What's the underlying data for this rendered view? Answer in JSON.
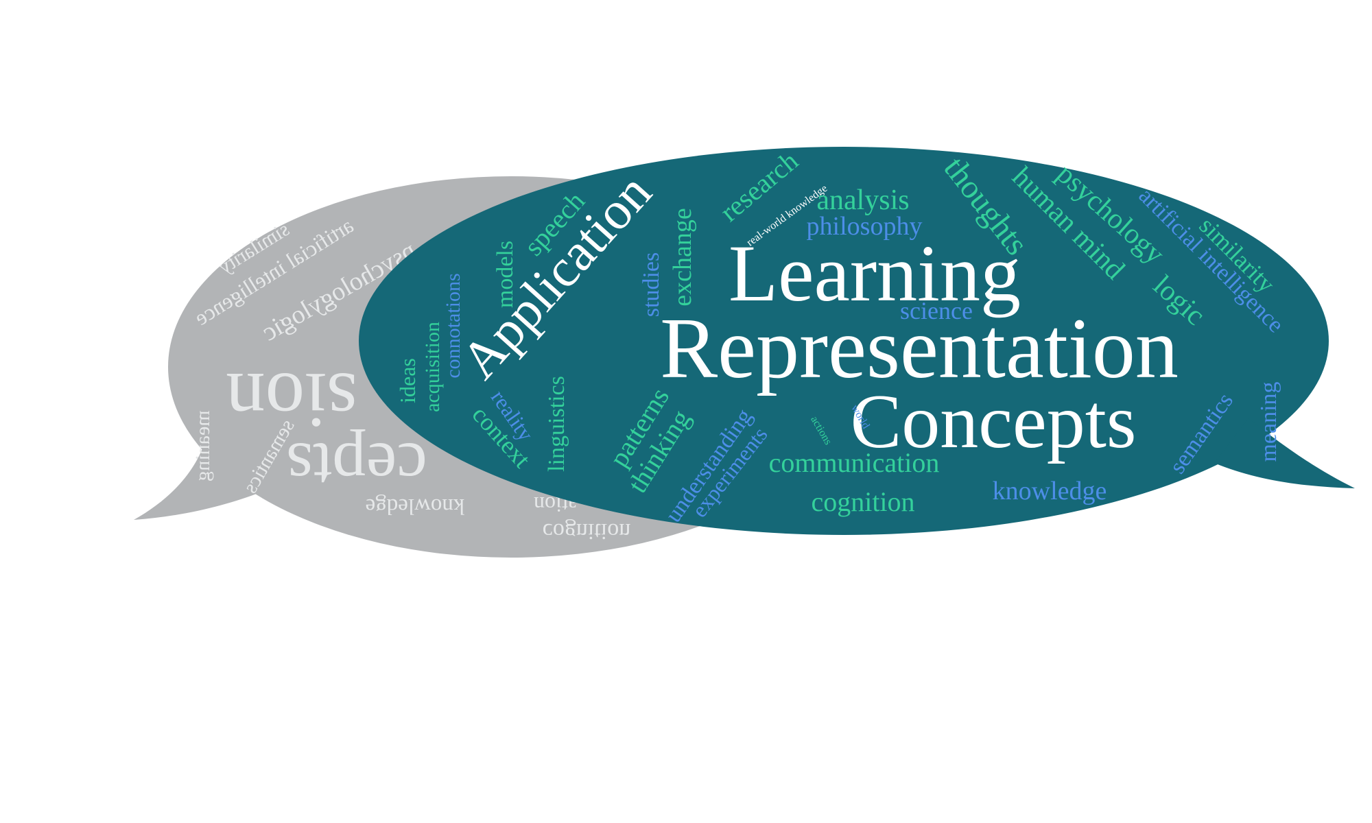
{
  "colors": {
    "background": "#ffffff",
    "front_bubble": "#156877",
    "back_bubble": "#b2b4b6",
    "white_text": "#ffffff",
    "green_text": "#34d19b",
    "blue_text": "#4d8ee8",
    "ghost_text": "#e6e8e9"
  },
  "front_cloud": {
    "learning": "Learning",
    "representation": "Representation",
    "concepts": "Concepts",
    "application": "Application",
    "speech": "speech",
    "research": "research",
    "real_world_knowledge": "real-world knowledge",
    "analysis": "analysis",
    "philosophy": "philosophy",
    "thoughts": "thoughts",
    "human_mind": "human mind",
    "psychology": "psychology",
    "artificial_intelligence": "artificial intelligence",
    "similarity": "similarity",
    "logic": "logic",
    "science": "science",
    "models": "models",
    "connotations": "connotations",
    "acquisition": "acquisition",
    "ideas": "ideas",
    "studies": "studies",
    "exchange": "exchange",
    "reality": "reality",
    "context": "context",
    "linguistics": "linguistics",
    "patterns": "patterns",
    "thinking": "thinking",
    "understanding": "understanding",
    "experiments": "experiments",
    "actions": "actions",
    "world": "world",
    "communication": "communication",
    "cognition": "cognition",
    "knowledge": "knowledge",
    "semantics": "semantics",
    "meaning": "meaning"
  },
  "back_cloud": {
    "similarity": "similarity",
    "artificial_intelligence": "artificial intelligence",
    "psychology_logic": "psychologylogic",
    "meaning": "meaning",
    "semantics": "semantics",
    "representation_fragment": "sion",
    "concepts_fragment": "cepts",
    "knowledge": "knowledge",
    "cognition": "cognition",
    "communication_fragment": "ation"
  }
}
